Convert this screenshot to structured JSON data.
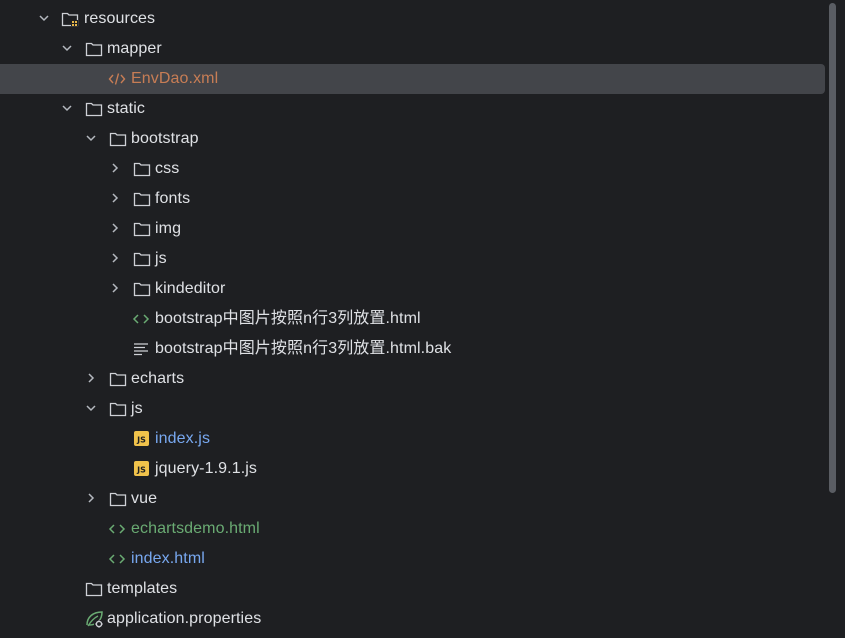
{
  "tree": {
    "items": [
      {
        "label": "resources",
        "icon": "resources-folder-icon",
        "chevron": "expanded"
      },
      {
        "label": "mapper",
        "icon": "folder-icon",
        "chevron": "expanded"
      },
      {
        "label": "EnvDao.xml",
        "icon": "xml-file-icon",
        "selected": true
      },
      {
        "label": "static",
        "icon": "folder-icon",
        "chevron": "expanded"
      },
      {
        "label": "bootstrap",
        "icon": "folder-icon",
        "chevron": "expanded"
      },
      {
        "label": "css",
        "icon": "folder-icon",
        "chevron": "collapsed"
      },
      {
        "label": "fonts",
        "icon": "folder-icon",
        "chevron": "collapsed"
      },
      {
        "label": "img",
        "icon": "folder-icon",
        "chevron": "collapsed"
      },
      {
        "label": "js",
        "icon": "folder-icon",
        "chevron": "collapsed"
      },
      {
        "label": "kindeditor",
        "icon": "folder-icon",
        "chevron": "collapsed"
      },
      {
        "label": "bootstrap中图片按照n行3列放置.html",
        "icon": "html-file-icon"
      },
      {
        "label": "bootstrap中图片按照n行3列放置.html.bak",
        "icon": "text-file-icon"
      },
      {
        "label": "echarts",
        "icon": "folder-icon",
        "chevron": "collapsed"
      },
      {
        "label": "js",
        "icon": "folder-icon",
        "chevron": "expanded"
      },
      {
        "label": "index.js",
        "icon": "js-file-icon"
      },
      {
        "label": "jquery-1.9.1.js",
        "icon": "js-file-icon"
      },
      {
        "label": "vue",
        "icon": "folder-icon",
        "chevron": "collapsed"
      },
      {
        "label": "echartsdemo.html",
        "icon": "html-file-icon"
      },
      {
        "label": "index.html",
        "icon": "html-file-icon"
      },
      {
        "label": "templates",
        "icon": "folder-icon"
      },
      {
        "label": "application.properties",
        "icon": "spring-properties-icon"
      }
    ]
  },
  "colors": {
    "background": "#1e1f22",
    "selection": "#43454a",
    "text": "#dfe1e5",
    "modified_blue": "#78a8f0",
    "added_green": "#6aab73",
    "xml_orange": "#c77d55",
    "js_badge": "#f0c24b"
  }
}
